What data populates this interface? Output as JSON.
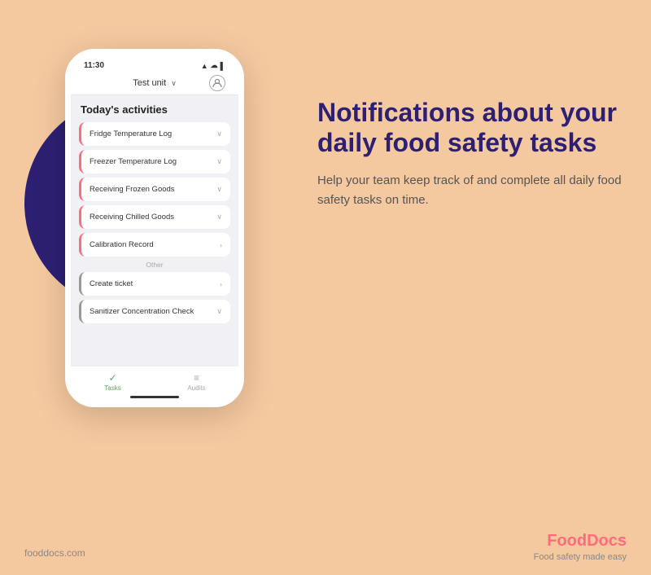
{
  "background_color": "#F5C9A0",
  "phone": {
    "status_bar": {
      "time": "11:30",
      "icons": "▲ ☰ ▌▌"
    },
    "nav": {
      "unit_label": "Test unit",
      "chevron": "∨",
      "profile_icon": "○"
    },
    "activities_title": "Today's activities",
    "activity_items": [
      {
        "label": "Fridge Temperature Log",
        "chevron": "∨",
        "border": "red"
      },
      {
        "label": "Freezer Temperature Log",
        "chevron": "∨",
        "border": "red"
      },
      {
        "label": "Receiving Frozen Goods",
        "chevron": "∨",
        "border": "red"
      },
      {
        "label": "Receiving Chilled Goods",
        "chevron": "∨",
        "border": "red"
      },
      {
        "label": "Calibration Record",
        "chevron": ">",
        "border": "red"
      }
    ],
    "section_label": "Other",
    "other_items": [
      {
        "label": "Create ticket",
        "chevron": ">",
        "border": "gray"
      },
      {
        "label": "Sanitizer Concentration Check",
        "chevron": "∨",
        "border": "gray"
      }
    ],
    "tab_bar": {
      "tabs": [
        {
          "icon": "✓",
          "label": "Tasks",
          "active": true
        },
        {
          "icon": "≡",
          "label": "Audits",
          "active": false
        }
      ]
    }
  },
  "right_content": {
    "headline": "Notifications about your daily food safety tasks",
    "subtext": "Help your team keep track of and complete all daily food safety tasks on time."
  },
  "footer": {
    "website": "fooddocs.com",
    "brand_name_part1": "Food",
    "brand_name_part2": "Docs",
    "tagline": "Food safety made easy"
  }
}
